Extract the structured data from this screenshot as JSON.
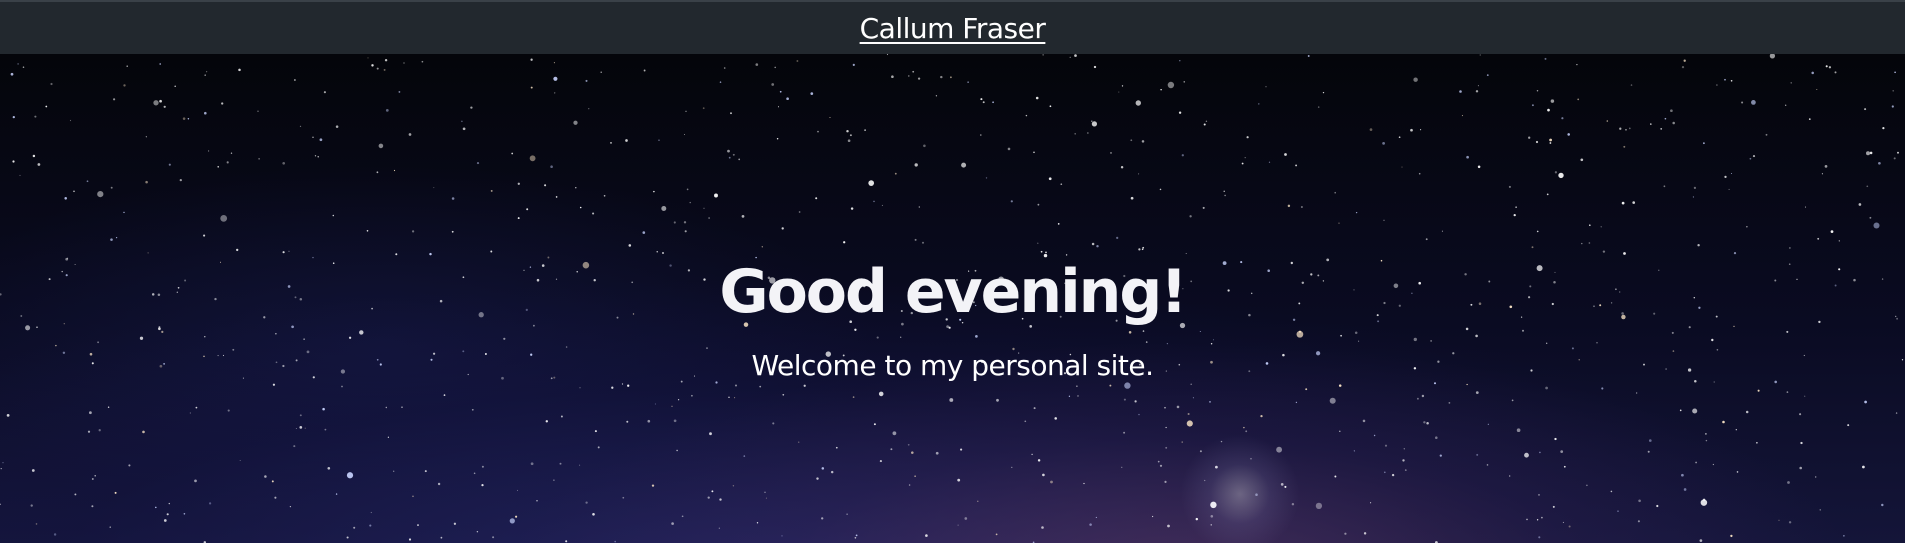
{
  "header": {
    "site_name": "Callum Fraser"
  },
  "hero": {
    "greeting": "Good evening!",
    "tagline": "Welcome to my personal site.",
    "background": "starry-night-sky",
    "moon_icon": "crescent-moon-icon"
  },
  "colors": {
    "header_bg": "#22282e",
    "text": "#ffffff",
    "sky_dark": "#04050a",
    "sky_glow": "#141539"
  }
}
